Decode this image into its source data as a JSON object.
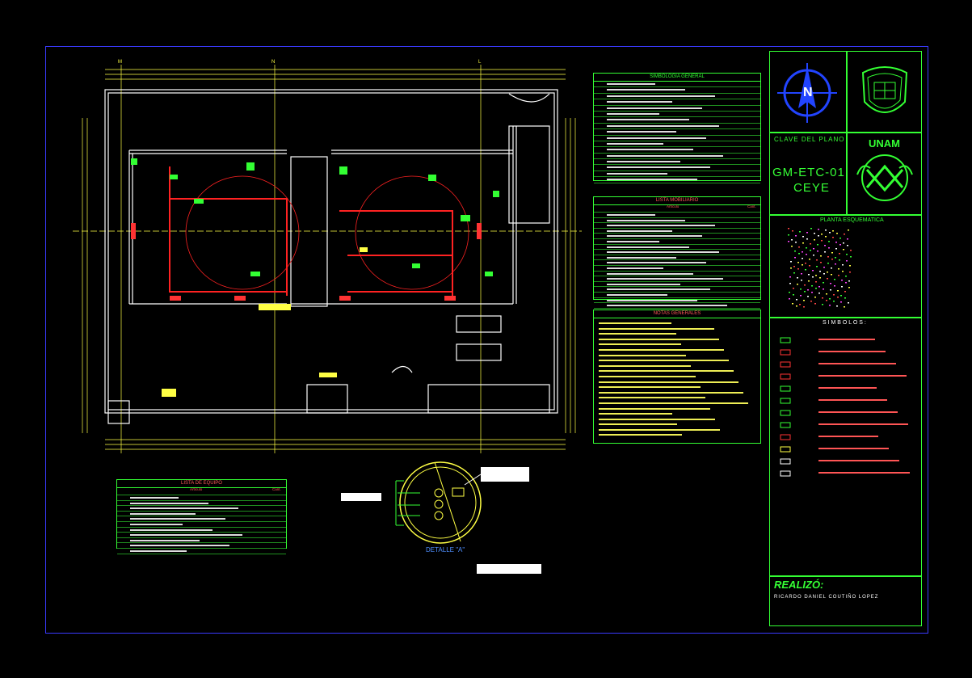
{
  "sheet": {
    "clave_title": "CLAVE DEL PLANO",
    "clave_code_line1": "GM-ETC-01",
    "clave_code_line2": "CEYE",
    "unam_label": "UNAM",
    "planta_title": "PLANTA ESQUEMATICA",
    "simbolos_title": "S I M B O L O S :",
    "realizo_label": "REALIZÓ:",
    "realizo_name": "RICARDO DANIEL COUTIÑO LOPEZ",
    "compass_letter": "N"
  },
  "detail": {
    "label": "DETALLE \"A\""
  },
  "tables": {
    "simbologia_title": "SIMBOLOGIA GENERAL",
    "mobiliario_title": "LISTA MOBILIARIO",
    "mobiliario_col_item": "Artículo",
    "mobiliario_col_qty": "Cant.",
    "notas_title": "NOTAS GENERALES",
    "equipo_title": "LISTA DE EQUIPO",
    "equipo_col_item": "Artículo",
    "equipo_col_qty": "Cant."
  },
  "grid_markers": {
    "top": [
      "M",
      "N",
      "L"
    ]
  },
  "colors": {
    "background": "#000000",
    "frame": "#3a3aff",
    "lines": "#33ff33",
    "walls": "#ffffff",
    "alert": "#ff2222",
    "dims": "#ffff44"
  }
}
